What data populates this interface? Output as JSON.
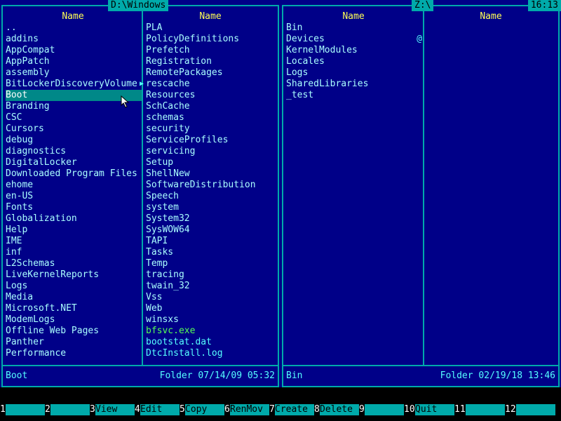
{
  "left_panel": {
    "title": "D:\\Windows",
    "col1_header": "Name",
    "col2_header": "Name",
    "col1": [
      "..",
      "addins",
      "AppCompat",
      "AppPatch",
      "assembly",
      "BitLockerDiscoveryVolume",
      "Boot",
      "Branding",
      "CSC",
      "Cursors",
      "debug",
      "diagnostics",
      "DigitalLocker",
      "Downloaded Program Files",
      "ehome",
      "en-US",
      "Fonts",
      "Globalization",
      "Help",
      "IME",
      "inf",
      "L2Schemas",
      "LiveKernelReports",
      "Logs",
      "Media",
      "Microsoft.NET",
      "ModemLogs",
      "Offline Web Pages",
      "Panther",
      "Performance"
    ],
    "col2": [
      "PLA",
      "PolicyDefinitions",
      "Prefetch",
      "Registration",
      "RemotePackages",
      "rescache",
      "Resources",
      "SchCache",
      "schemas",
      "security",
      "ServiceProfiles",
      "servicing",
      "Setup",
      "ShellNew",
      "SoftwareDistribution",
      "Speech",
      "system",
      "System32",
      "SysWOW64",
      "TAPI",
      "Tasks",
      "Temp",
      "tracing",
      "twain_32",
      "Vss",
      "Web",
      "winsxs",
      "bfsvc.exe",
      "bootstat.dat",
      "DtcInstall.log"
    ],
    "status_name": "Boot",
    "status_info": "Folder 07/14/09 05:32"
  },
  "right_panel": {
    "title": "Z:\\",
    "clock": "16:13",
    "col1_header": "Name",
    "col2_header": "Name",
    "col1": [
      "Bin",
      "Devices",
      "KernelModules",
      "Locales",
      "Logs",
      "SharedLibraries",
      "_test"
    ],
    "col2": [],
    "status_name": "Bin",
    "status_info": "Folder 02/19/18 13:46"
  },
  "fkeys": [
    {
      "num": "1",
      "label": ""
    },
    {
      "num": "2",
      "label": ""
    },
    {
      "num": "3",
      "label": "View"
    },
    {
      "num": "4",
      "label": "Edit"
    },
    {
      "num": "5",
      "label": "Copy"
    },
    {
      "num": "6",
      "label": "RenMov"
    },
    {
      "num": "7",
      "label": "Create"
    },
    {
      "num": "8",
      "label": "Delete"
    },
    {
      "num": "9",
      "label": ""
    },
    {
      "num": "10",
      "label": "Quit"
    },
    {
      "num": "11",
      "label": ""
    },
    {
      "num": "12",
      "label": ""
    }
  ],
  "colors": {
    "panel_bg": "#000088",
    "frame": "#00aaaa",
    "header": "#ffff55",
    "dir": "#aaffff",
    "file": "#55ffff",
    "exe": "#55ff55",
    "selection": "#008888"
  }
}
